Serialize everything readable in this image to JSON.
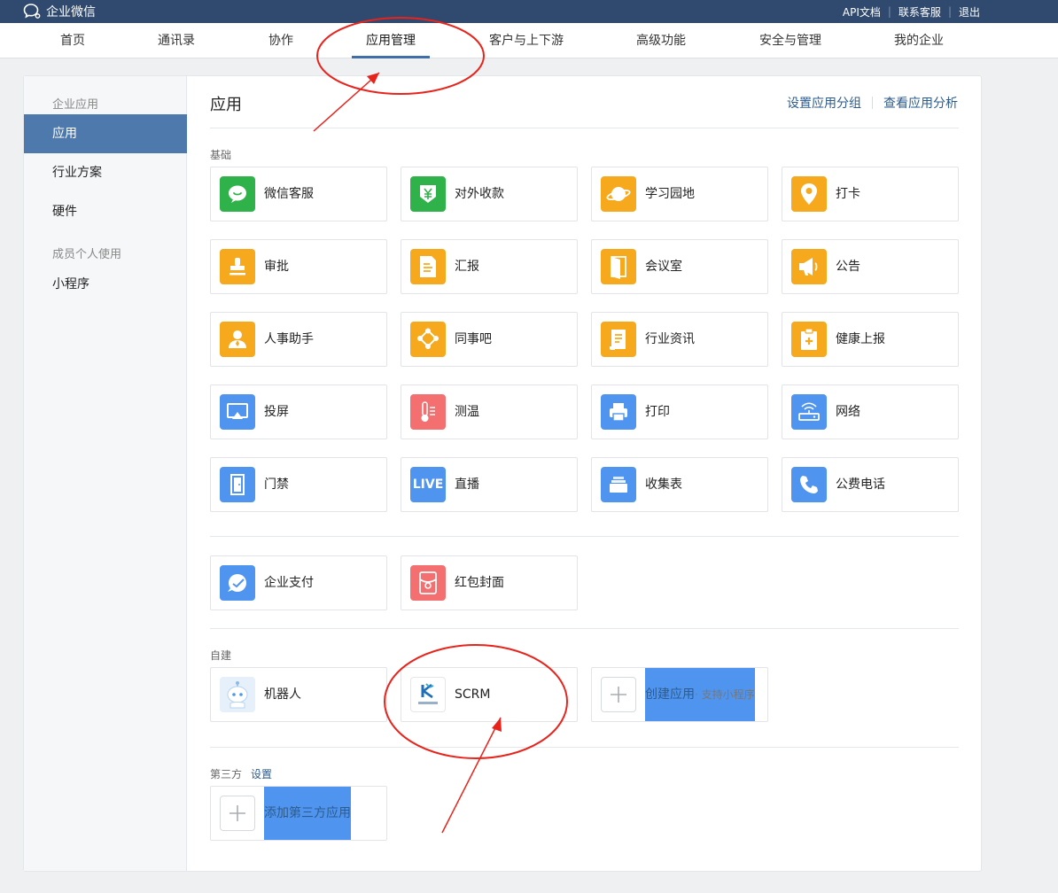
{
  "app": {
    "brand": "企业微信",
    "top_links": [
      "API文档",
      "联系客服",
      "退出"
    ]
  },
  "nav": {
    "items": [
      "首页",
      "通讯录",
      "协作",
      "应用管理",
      "客户与上下游",
      "高级功能",
      "安全与管理",
      "我的企业"
    ],
    "active": "应用管理"
  },
  "sidebar": {
    "group1": "企业应用",
    "items1": [
      "应用",
      "行业方案",
      "硬件"
    ],
    "active": "应用",
    "group2": "成员个人使用",
    "items2": [
      "小程序"
    ]
  },
  "main": {
    "title": "应用",
    "actions": [
      "设置应用分组",
      "查看应用分析"
    ],
    "basic_label": "基础",
    "basic_apps": [
      {
        "name": "微信客服",
        "icon": "chat-bubble-icon"
      },
      {
        "name": "对外收款",
        "icon": "yuan-shield-icon"
      },
      {
        "name": "学习园地",
        "icon": "planet-icon"
      },
      {
        "name": "打卡",
        "icon": "location-pin-icon"
      },
      {
        "name": "审批",
        "icon": "stamp-icon"
      },
      {
        "name": "汇报",
        "icon": "report-doc-icon"
      },
      {
        "name": "会议室",
        "icon": "door-open-icon"
      },
      {
        "name": "公告",
        "icon": "megaphone-icon"
      },
      {
        "name": "人事助手",
        "icon": "person-badge-icon"
      },
      {
        "name": "同事吧",
        "icon": "network-nodes-icon"
      },
      {
        "name": "行业资讯",
        "icon": "news-doc-icon"
      },
      {
        "name": "健康上报",
        "icon": "health-clipboard-icon"
      },
      {
        "name": "投屏",
        "icon": "screen-cast-icon"
      },
      {
        "name": "测温",
        "icon": "thermometer-icon"
      },
      {
        "name": "打印",
        "icon": "printer-icon"
      },
      {
        "name": "网络",
        "icon": "router-icon"
      },
      {
        "name": "门禁",
        "icon": "door-icon"
      },
      {
        "name": "直播",
        "icon": "live-icon"
      },
      {
        "name": "收集表",
        "icon": "form-stack-icon"
      },
      {
        "name": "公费电话",
        "icon": "phone-icon"
      }
    ],
    "pay_apps": [
      {
        "name": "企业支付",
        "icon": "pay-icon"
      },
      {
        "name": "红包封面",
        "icon": "red-envelope-icon"
      }
    ],
    "custom_label": "自建",
    "custom_apps": [
      {
        "name": "机器人",
        "icon": "robot-icon"
      },
      {
        "name": "SCRM",
        "icon": "scrm-logo-icon"
      }
    ],
    "create_app": {
      "label": "创建应用",
      "sub": "· 支持小程序"
    },
    "third_party_label": "第三方",
    "third_party_setting": "设置",
    "add_third_party": "添加第三方应用",
    "live_text": "LIVE"
  },
  "colors": {
    "topbar": "#2f4a6e",
    "accent": "#4e79ad",
    "link": "#2d5b8d",
    "green": "#2fb24a",
    "orange": "#f6a91d",
    "blue": "#4f95f0",
    "red": "#f46f6f",
    "annotation": "#e8231c"
  }
}
